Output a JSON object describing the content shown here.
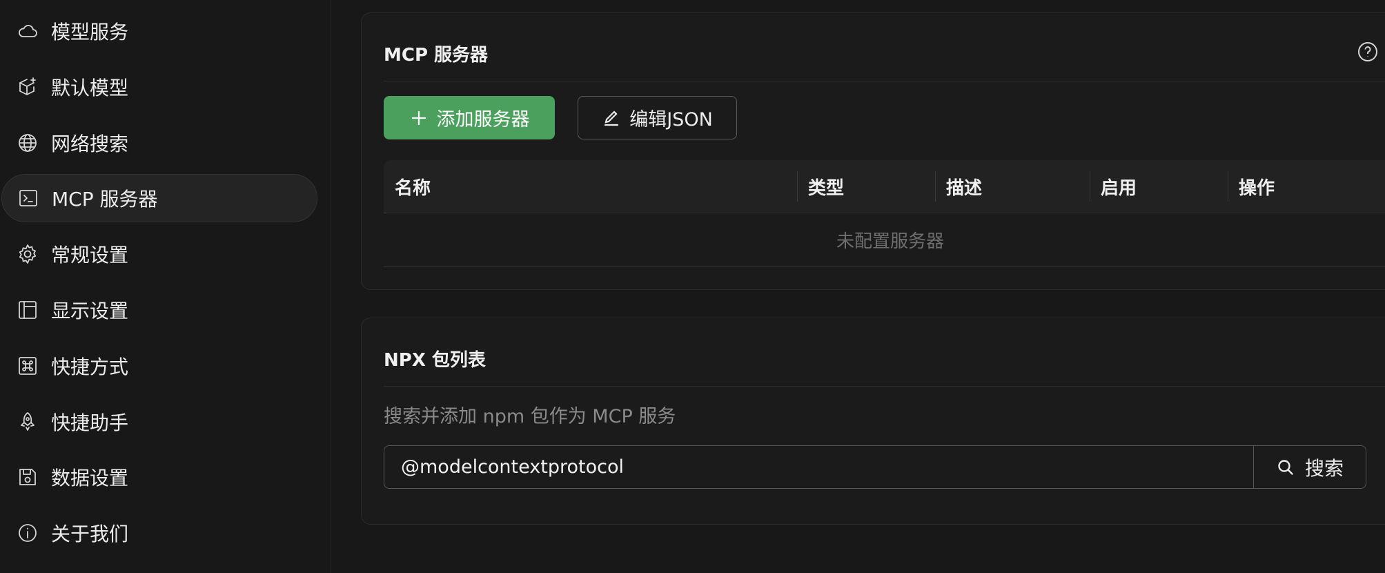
{
  "sidebar": {
    "items": [
      {
        "label": "模型服务",
        "icon": "cloud-icon"
      },
      {
        "label": "默认模型",
        "icon": "cube-sparkle-icon"
      },
      {
        "label": "网络搜索",
        "icon": "globe-icon"
      },
      {
        "label": "MCP 服务器",
        "icon": "terminal-icon",
        "active": true
      },
      {
        "label": "常规设置",
        "icon": "gear-icon"
      },
      {
        "label": "显示设置",
        "icon": "layout-icon"
      },
      {
        "label": "快捷方式",
        "icon": "command-icon"
      },
      {
        "label": "快捷助手",
        "icon": "rocket-icon"
      },
      {
        "label": "数据设置",
        "icon": "save-icon"
      },
      {
        "label": "关于我们",
        "icon": "info-icon"
      }
    ]
  },
  "mcp": {
    "title": "MCP 服务器",
    "add_button": "添加服务器",
    "edit_json_button": "编辑JSON",
    "columns": [
      "名称",
      "类型",
      "描述",
      "启用",
      "操作"
    ],
    "empty_text": "未配置服务器"
  },
  "npx": {
    "title": "NPX 包列表",
    "description": "搜索并添加 npm 包作为 MCP 服务",
    "search_value": "@modelcontextprotocol",
    "search_button": "搜索"
  },
  "colors": {
    "accent_green": "#4aa05c",
    "background": "#181818",
    "card": "#1b1b1b"
  }
}
